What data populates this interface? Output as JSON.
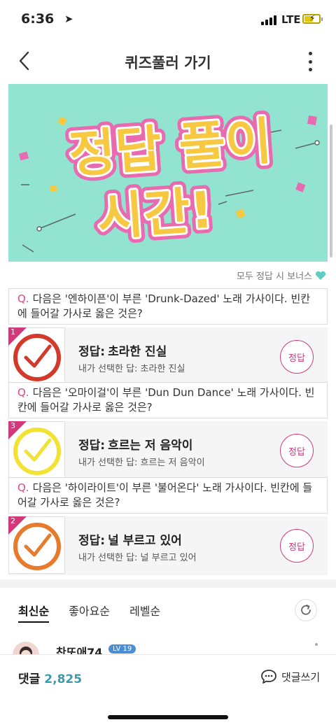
{
  "status": {
    "time": "6:36",
    "network": "LTE"
  },
  "header": {
    "title": "퀴즈풀러 가기"
  },
  "banner": {
    "line1": "정답 풀이",
    "line2": "시간!",
    "colors": {
      "bg": "#92e3cf",
      "text": "#f7c842",
      "outline": "#e86bb0"
    }
  },
  "bonus_label": "모두 정답 시 보너스",
  "quiz": [
    {
      "question_prefix": "Q.",
      "question": "다음은 '엔하이픈'이 부른 'Drunk-Dazed' 노래 가사이다. 빈칸에 들어갈 가사로 옳은 것은?",
      "number": "1",
      "answer_label": "정답",
      "answer": "초라한 진실",
      "my_answer_label": "내가 선택한 답:",
      "my_answer": "초라한 진실",
      "button": "정답",
      "check_color": "#d33a2c"
    },
    {
      "question_prefix": "Q.",
      "question": "다음은 '오마이걸'이 부른 'Dun Dun Dance' 노래 가사이다. 빈칸에 들어갈 가사로 옳은 것은?",
      "number": "3",
      "answer_label": "정답",
      "answer": "흐르는 저 음악이",
      "my_answer_label": "내가 선택한 답:",
      "my_answer": "흐르는 저 음악이",
      "button": "정답",
      "check_color": "#f2e233"
    },
    {
      "question_prefix": "Q.",
      "question": "다음은 '하이라이트'이 부른 '불어온다' 노래 가사이다. 빈칸에 들어갈 가사로 옳은 것은?",
      "number": "2",
      "answer_label": "정답",
      "answer": "널 부르고 있어",
      "my_answer_label": "내가 선택한 답:",
      "my_answer": "널 부르고 있어",
      "button": "정답",
      "check_color": "#e77a2c"
    }
  ],
  "tabs": [
    "최신순",
    "좋아요순",
    "레벨순"
  ],
  "comment": {
    "nickname": "찬또애74",
    "level": "LV 19"
  },
  "footer": {
    "comments_label": "댓글",
    "comments_count": "2,825",
    "write_label": "댓글쓰기"
  }
}
